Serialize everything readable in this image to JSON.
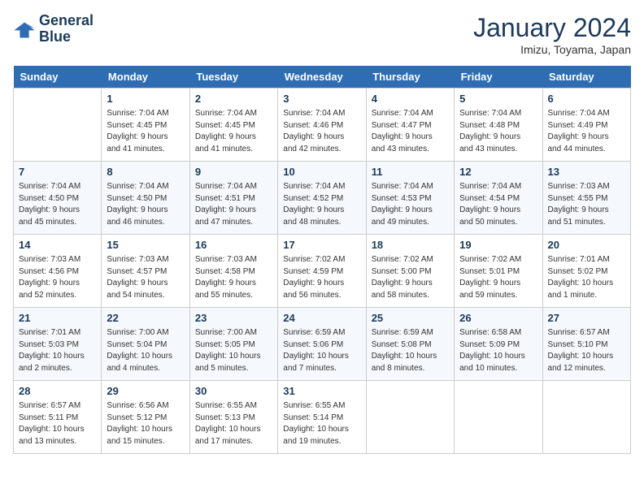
{
  "logo": {
    "line1": "General",
    "line2": "Blue"
  },
  "title": "January 2024",
  "subtitle": "Imizu, Toyama, Japan",
  "days_of_week": [
    "Sunday",
    "Monday",
    "Tuesday",
    "Wednesday",
    "Thursday",
    "Friday",
    "Saturday"
  ],
  "weeks": [
    [
      {
        "day": "",
        "info": ""
      },
      {
        "day": "1",
        "info": "Sunrise: 7:04 AM\nSunset: 4:45 PM\nDaylight: 9 hours\nand 41 minutes."
      },
      {
        "day": "2",
        "info": "Sunrise: 7:04 AM\nSunset: 4:45 PM\nDaylight: 9 hours\nand 41 minutes."
      },
      {
        "day": "3",
        "info": "Sunrise: 7:04 AM\nSunset: 4:46 PM\nDaylight: 9 hours\nand 42 minutes."
      },
      {
        "day": "4",
        "info": "Sunrise: 7:04 AM\nSunset: 4:47 PM\nDaylight: 9 hours\nand 43 minutes."
      },
      {
        "day": "5",
        "info": "Sunrise: 7:04 AM\nSunset: 4:48 PM\nDaylight: 9 hours\nand 43 minutes."
      },
      {
        "day": "6",
        "info": "Sunrise: 7:04 AM\nSunset: 4:49 PM\nDaylight: 9 hours\nand 44 minutes."
      }
    ],
    [
      {
        "day": "7",
        "info": "Sunrise: 7:04 AM\nSunset: 4:50 PM\nDaylight: 9 hours\nand 45 minutes."
      },
      {
        "day": "8",
        "info": "Sunrise: 7:04 AM\nSunset: 4:50 PM\nDaylight: 9 hours\nand 46 minutes."
      },
      {
        "day": "9",
        "info": "Sunrise: 7:04 AM\nSunset: 4:51 PM\nDaylight: 9 hours\nand 47 minutes."
      },
      {
        "day": "10",
        "info": "Sunrise: 7:04 AM\nSunset: 4:52 PM\nDaylight: 9 hours\nand 48 minutes."
      },
      {
        "day": "11",
        "info": "Sunrise: 7:04 AM\nSunset: 4:53 PM\nDaylight: 9 hours\nand 49 minutes."
      },
      {
        "day": "12",
        "info": "Sunrise: 7:04 AM\nSunset: 4:54 PM\nDaylight: 9 hours\nand 50 minutes."
      },
      {
        "day": "13",
        "info": "Sunrise: 7:03 AM\nSunset: 4:55 PM\nDaylight: 9 hours\nand 51 minutes."
      }
    ],
    [
      {
        "day": "14",
        "info": "Sunrise: 7:03 AM\nSunset: 4:56 PM\nDaylight: 9 hours\nand 52 minutes."
      },
      {
        "day": "15",
        "info": "Sunrise: 7:03 AM\nSunset: 4:57 PM\nDaylight: 9 hours\nand 54 minutes."
      },
      {
        "day": "16",
        "info": "Sunrise: 7:03 AM\nSunset: 4:58 PM\nDaylight: 9 hours\nand 55 minutes."
      },
      {
        "day": "17",
        "info": "Sunrise: 7:02 AM\nSunset: 4:59 PM\nDaylight: 9 hours\nand 56 minutes."
      },
      {
        "day": "18",
        "info": "Sunrise: 7:02 AM\nSunset: 5:00 PM\nDaylight: 9 hours\nand 58 minutes."
      },
      {
        "day": "19",
        "info": "Sunrise: 7:02 AM\nSunset: 5:01 PM\nDaylight: 9 hours\nand 59 minutes."
      },
      {
        "day": "20",
        "info": "Sunrise: 7:01 AM\nSunset: 5:02 PM\nDaylight: 10 hours\nand 1 minute."
      }
    ],
    [
      {
        "day": "21",
        "info": "Sunrise: 7:01 AM\nSunset: 5:03 PM\nDaylight: 10 hours\nand 2 minutes."
      },
      {
        "day": "22",
        "info": "Sunrise: 7:00 AM\nSunset: 5:04 PM\nDaylight: 10 hours\nand 4 minutes."
      },
      {
        "day": "23",
        "info": "Sunrise: 7:00 AM\nSunset: 5:05 PM\nDaylight: 10 hours\nand 5 minutes."
      },
      {
        "day": "24",
        "info": "Sunrise: 6:59 AM\nSunset: 5:06 PM\nDaylight: 10 hours\nand 7 minutes."
      },
      {
        "day": "25",
        "info": "Sunrise: 6:59 AM\nSunset: 5:08 PM\nDaylight: 10 hours\nand 8 minutes."
      },
      {
        "day": "26",
        "info": "Sunrise: 6:58 AM\nSunset: 5:09 PM\nDaylight: 10 hours\nand 10 minutes."
      },
      {
        "day": "27",
        "info": "Sunrise: 6:57 AM\nSunset: 5:10 PM\nDaylight: 10 hours\nand 12 minutes."
      }
    ],
    [
      {
        "day": "28",
        "info": "Sunrise: 6:57 AM\nSunset: 5:11 PM\nDaylight: 10 hours\nand 13 minutes."
      },
      {
        "day": "29",
        "info": "Sunrise: 6:56 AM\nSunset: 5:12 PM\nDaylight: 10 hours\nand 15 minutes."
      },
      {
        "day": "30",
        "info": "Sunrise: 6:55 AM\nSunset: 5:13 PM\nDaylight: 10 hours\nand 17 minutes."
      },
      {
        "day": "31",
        "info": "Sunrise: 6:55 AM\nSunset: 5:14 PM\nDaylight: 10 hours\nand 19 minutes."
      },
      {
        "day": "",
        "info": ""
      },
      {
        "day": "",
        "info": ""
      },
      {
        "day": "",
        "info": ""
      }
    ]
  ]
}
